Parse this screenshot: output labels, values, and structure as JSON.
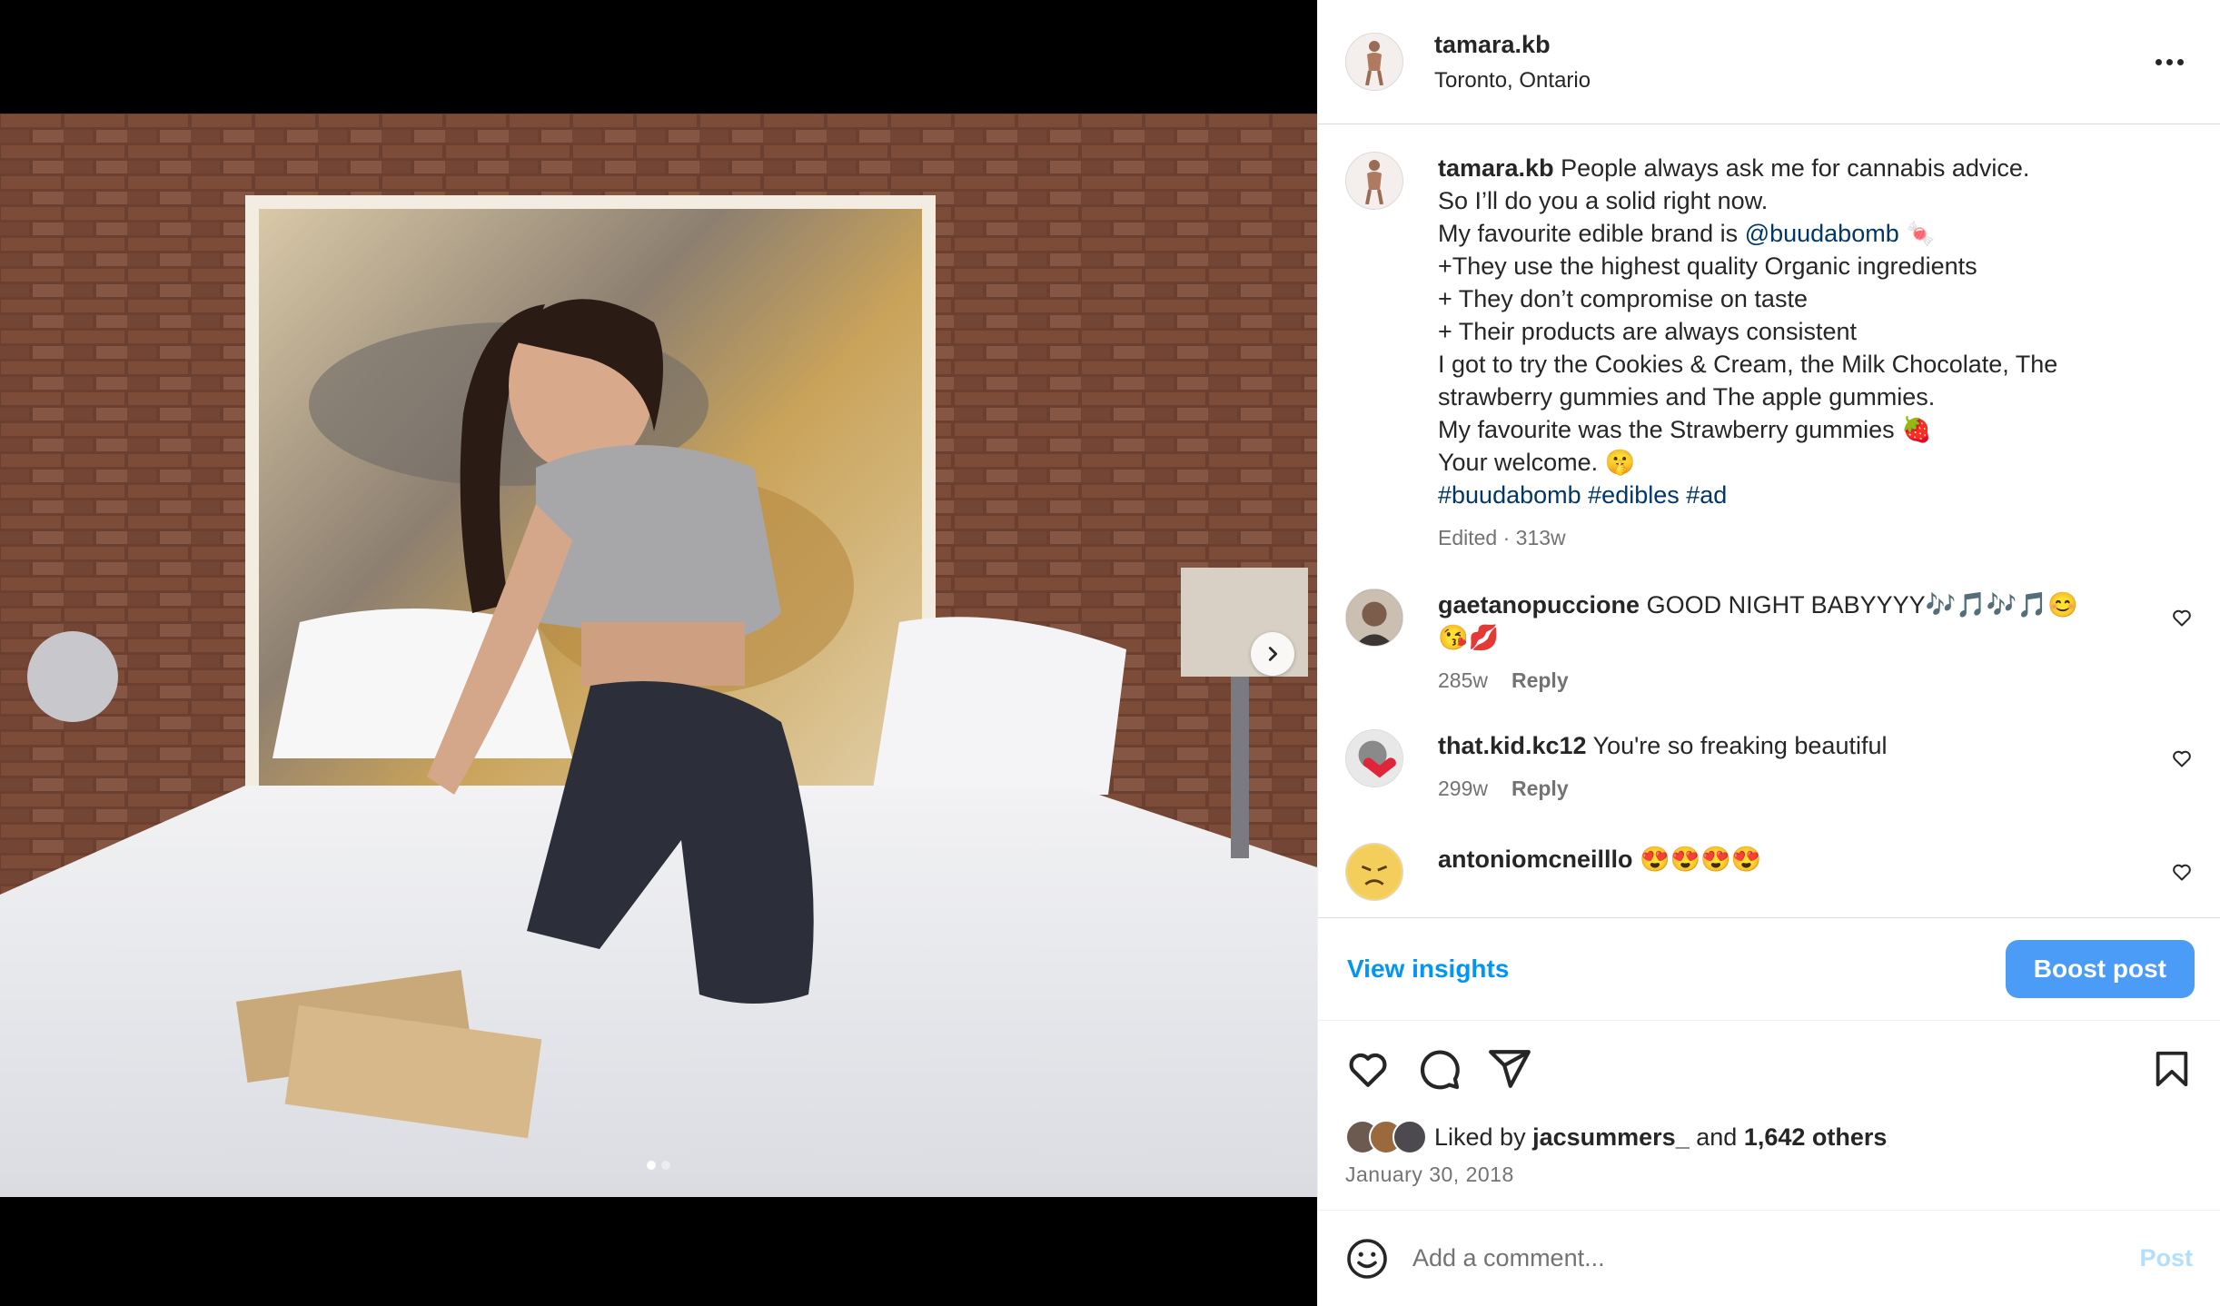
{
  "post": {
    "username": "tamara.kb",
    "location": "Toronto, Ontario",
    "carousel": {
      "current": 1,
      "total": 2
    }
  },
  "caption": {
    "username": "tamara.kb",
    "lines": [
      "People always ask me for cannabis advice.",
      "So I’ll do you a solid right now.",
      "My favourite edible brand is",
      "+They use the highest quality Organic ingredients",
      "+ They don’t compromise on taste",
      "+ Their products are always consistent",
      "I got to try the Cookies & Cream, the Milk Chocolate, The",
      "strawberry gummies and The apple gummies.",
      "My favourite was the Strawberry gummies 🍓",
      "Your welcome. 🤫"
    ],
    "mention": "@buudabomb",
    "mention_emoji": "🍬",
    "hashtags": [
      "#buudabomb",
      "#edibles",
      "#ad"
    ],
    "meta": "Edited · 313w"
  },
  "comments": [
    {
      "username": "gaetanopuccione",
      "text": "GOOD NIGHT BABYYYY🎶🎵🎶🎵😊",
      "text2": "😘💋",
      "age": "285w",
      "reply": "Reply"
    },
    {
      "username": "that.kid.kc12",
      "text": "You're so freaking beautiful",
      "age": "299w",
      "reply": "Reply"
    },
    {
      "username": "antoniomcneilllo",
      "text": "😍😍😍😍"
    }
  ],
  "actions": {
    "view_insights": "View insights",
    "boost_post": "Boost post"
  },
  "likes": {
    "prefix": "Liked by",
    "user": "jacsummers_",
    "connector": "and",
    "others": "1,642 others"
  },
  "date": "January 30, 2018",
  "add_comment": {
    "placeholder": "Add a comment...",
    "post_label": "Post"
  },
  "colors": {
    "link": "#00376b",
    "accent": "#0095f6",
    "boost": "#4a9cf6",
    "muted": "#737373"
  },
  "icons": {
    "more": "more-horizontal-icon",
    "next": "chevron-right-icon",
    "like": "heart-icon",
    "comment": "comment-bubble-icon",
    "share": "paper-plane-icon",
    "save": "bookmark-icon",
    "emoji": "smiley-icon"
  }
}
